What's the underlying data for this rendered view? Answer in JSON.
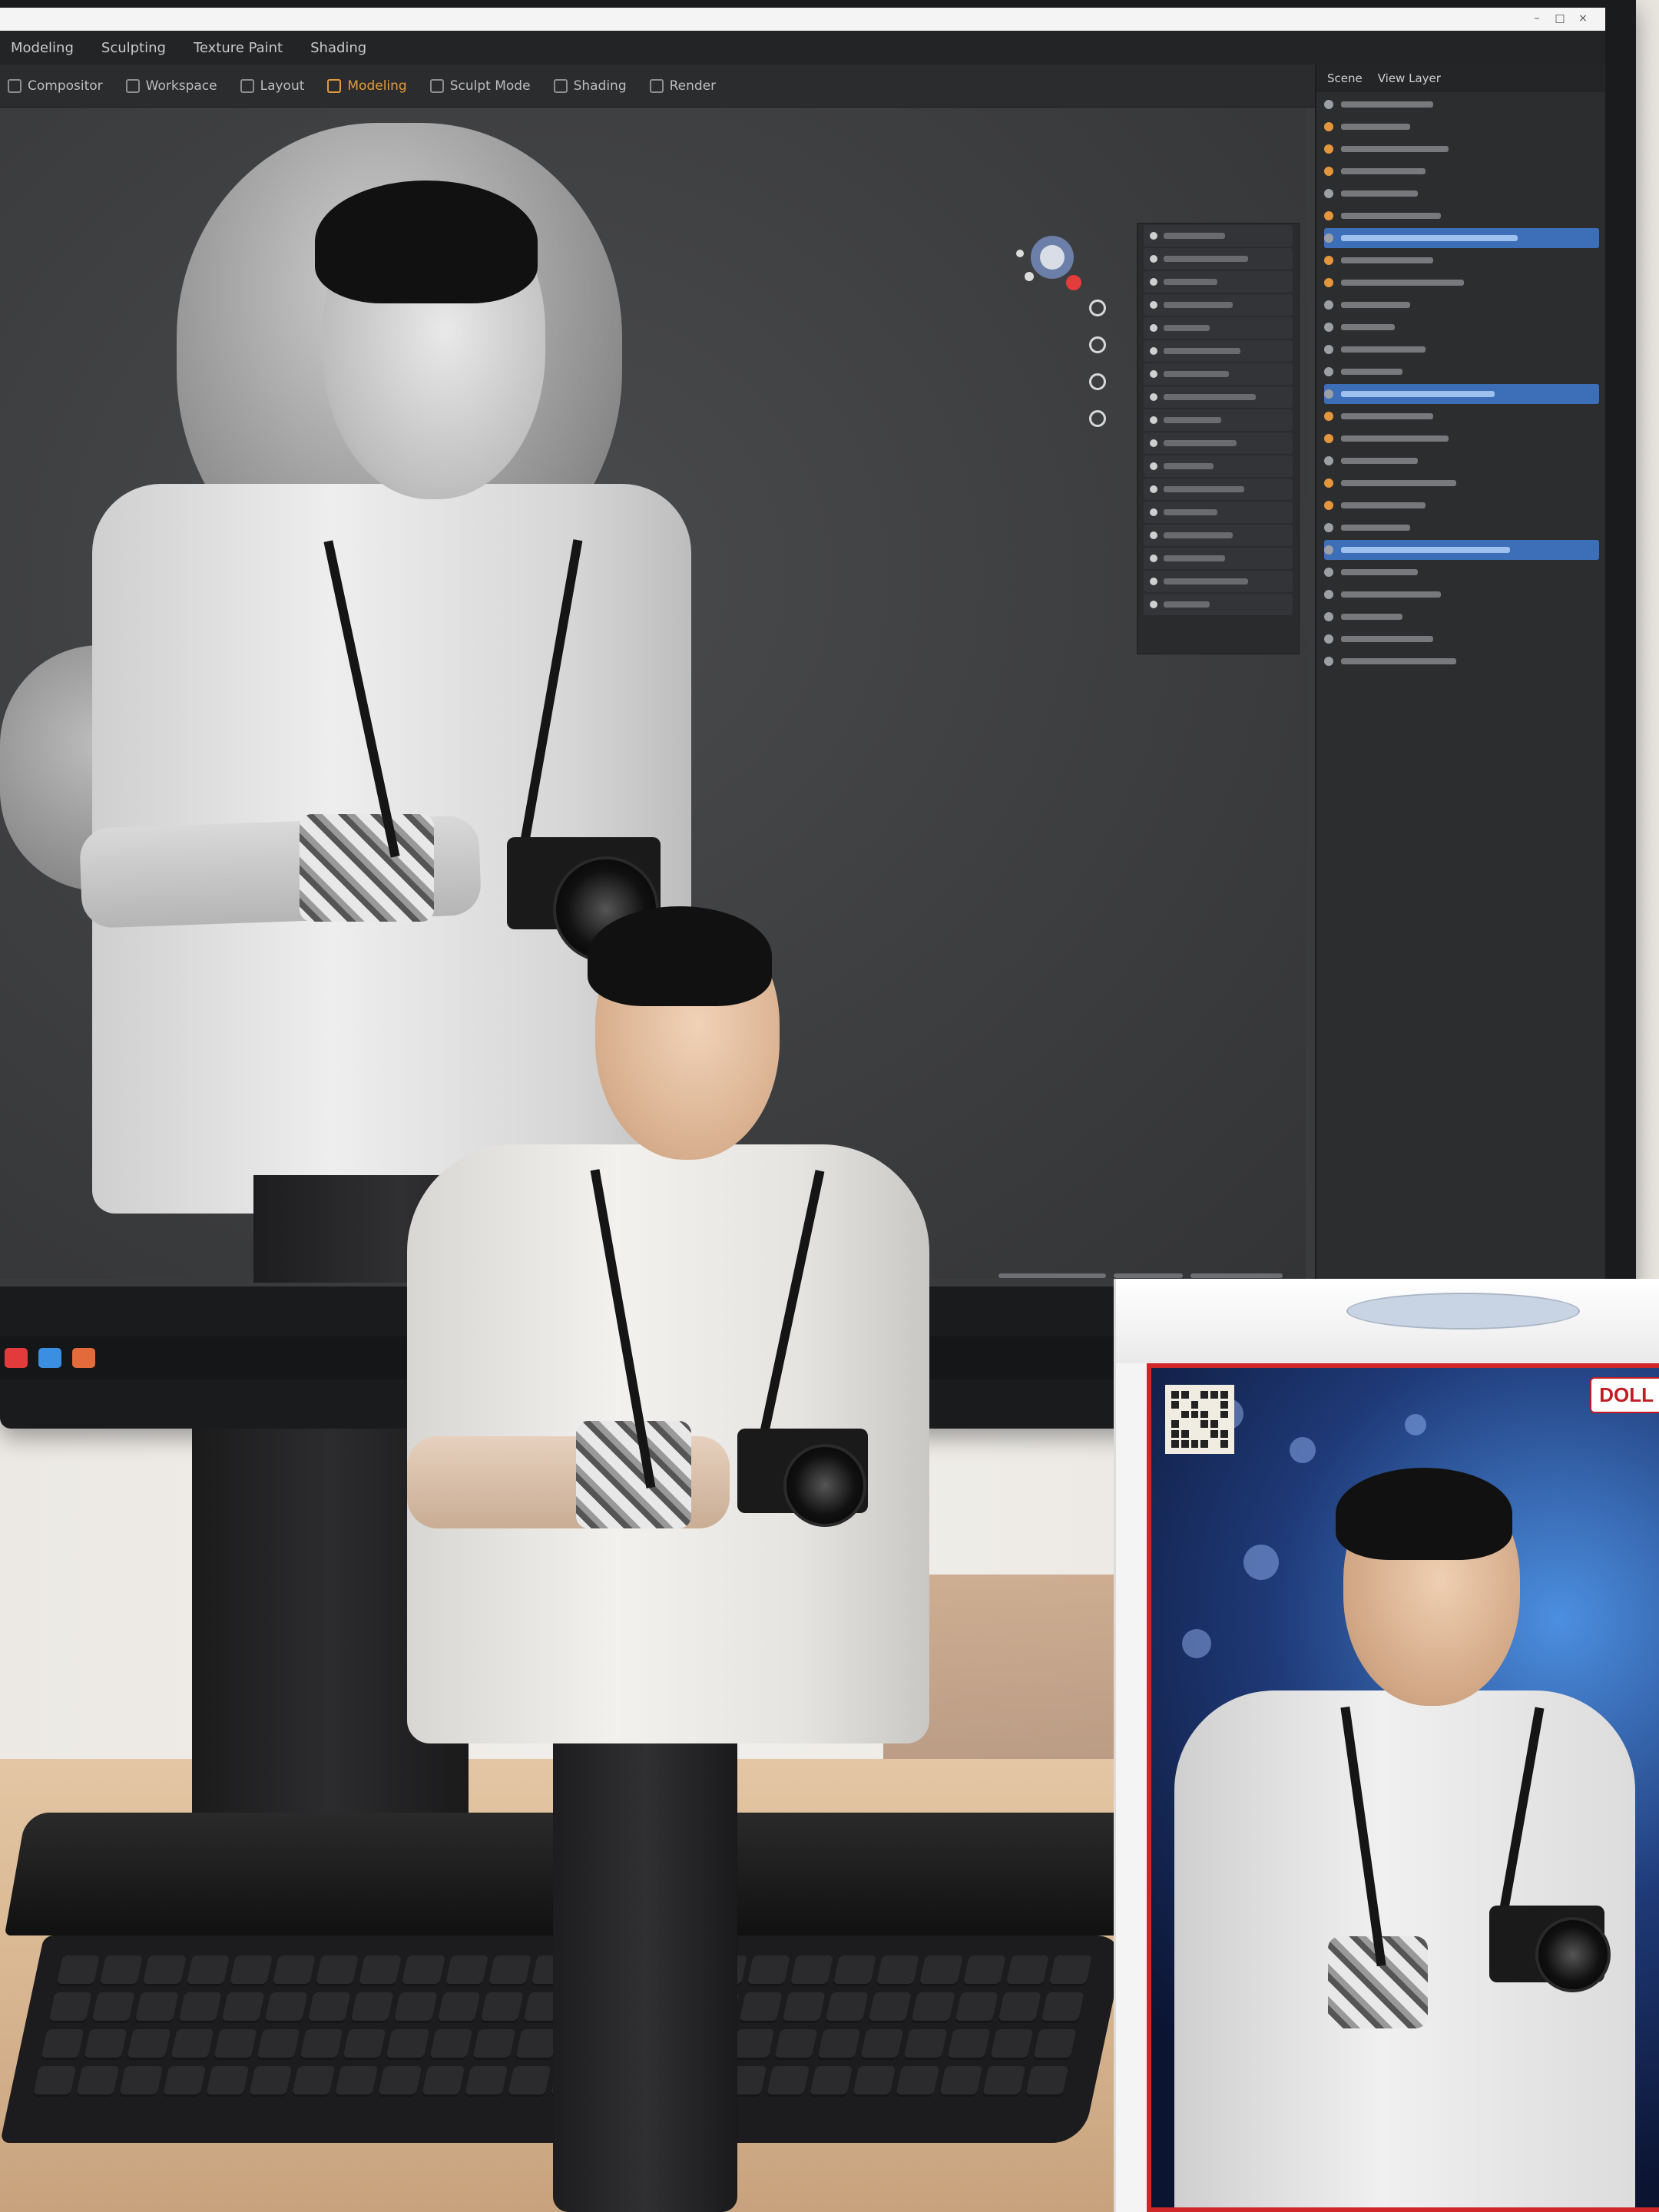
{
  "image": {
    "scene": "photo",
    "colors": {
      "accent_orange": "#e39a3c",
      "selection_blue": "#3d6fb8",
      "box_red": "#d0262a"
    }
  },
  "software": {
    "menu": [
      "Modeling",
      "Sculpting",
      "Texture Paint",
      "Shading"
    ],
    "tools": [
      {
        "label": "Compositor",
        "icon": "layers-icon"
      },
      {
        "label": "Workspace",
        "icon": "grid-icon"
      },
      {
        "label": "Layout",
        "icon": "layout-icon"
      },
      {
        "label": "Modeling",
        "icon": "cube-icon"
      },
      {
        "label": "Sculpt Mode",
        "icon": "brush-icon"
      },
      {
        "label": "Shading",
        "icon": "sphere-icon"
      },
      {
        "label": "Render",
        "icon": "camera-icon"
      }
    ],
    "props_tabs": [
      "Scene",
      "View Layer"
    ]
  },
  "box": {
    "brand": "DOLL"
  }
}
